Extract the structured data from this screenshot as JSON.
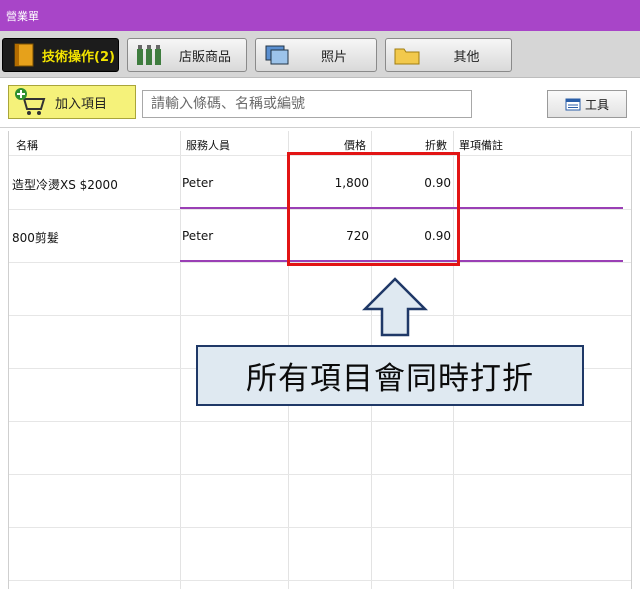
{
  "window": {
    "title": "營業單"
  },
  "tabs": [
    {
      "label": "技術操作(2)",
      "icon": "book-icon",
      "active": true
    },
    {
      "label": "店販商品",
      "icon": "bottles-icon",
      "active": false
    },
    {
      "label": "照片",
      "icon": "photo-icon",
      "active": false
    },
    {
      "label": "其他",
      "icon": "folder-icon",
      "active": false
    }
  ],
  "toolbar": {
    "add_label": "加入項目",
    "search_placeholder": "請輸入條碼、名稱或編號",
    "tools_label": "工具"
  },
  "table": {
    "columns": [
      "名稱",
      "服務人員",
      "價格",
      "折數",
      "單項備註"
    ],
    "rows": [
      {
        "name": "造型冷燙XS $2000",
        "staff": "Peter",
        "price": "1,800",
        "discount": "0.90",
        "note": ""
      },
      {
        "name": "800剪髮",
        "staff": "Peter",
        "price": "720",
        "discount": "0.90",
        "note": ""
      }
    ]
  },
  "annotation": {
    "text": "所有項目會同時打折"
  },
  "colors": {
    "titlebar": "#a845c8",
    "highlight": "#e21414",
    "row_separator": "#9a3fb5",
    "add_button": "#f5f27a",
    "callout_bg": "#dfe9f1"
  }
}
